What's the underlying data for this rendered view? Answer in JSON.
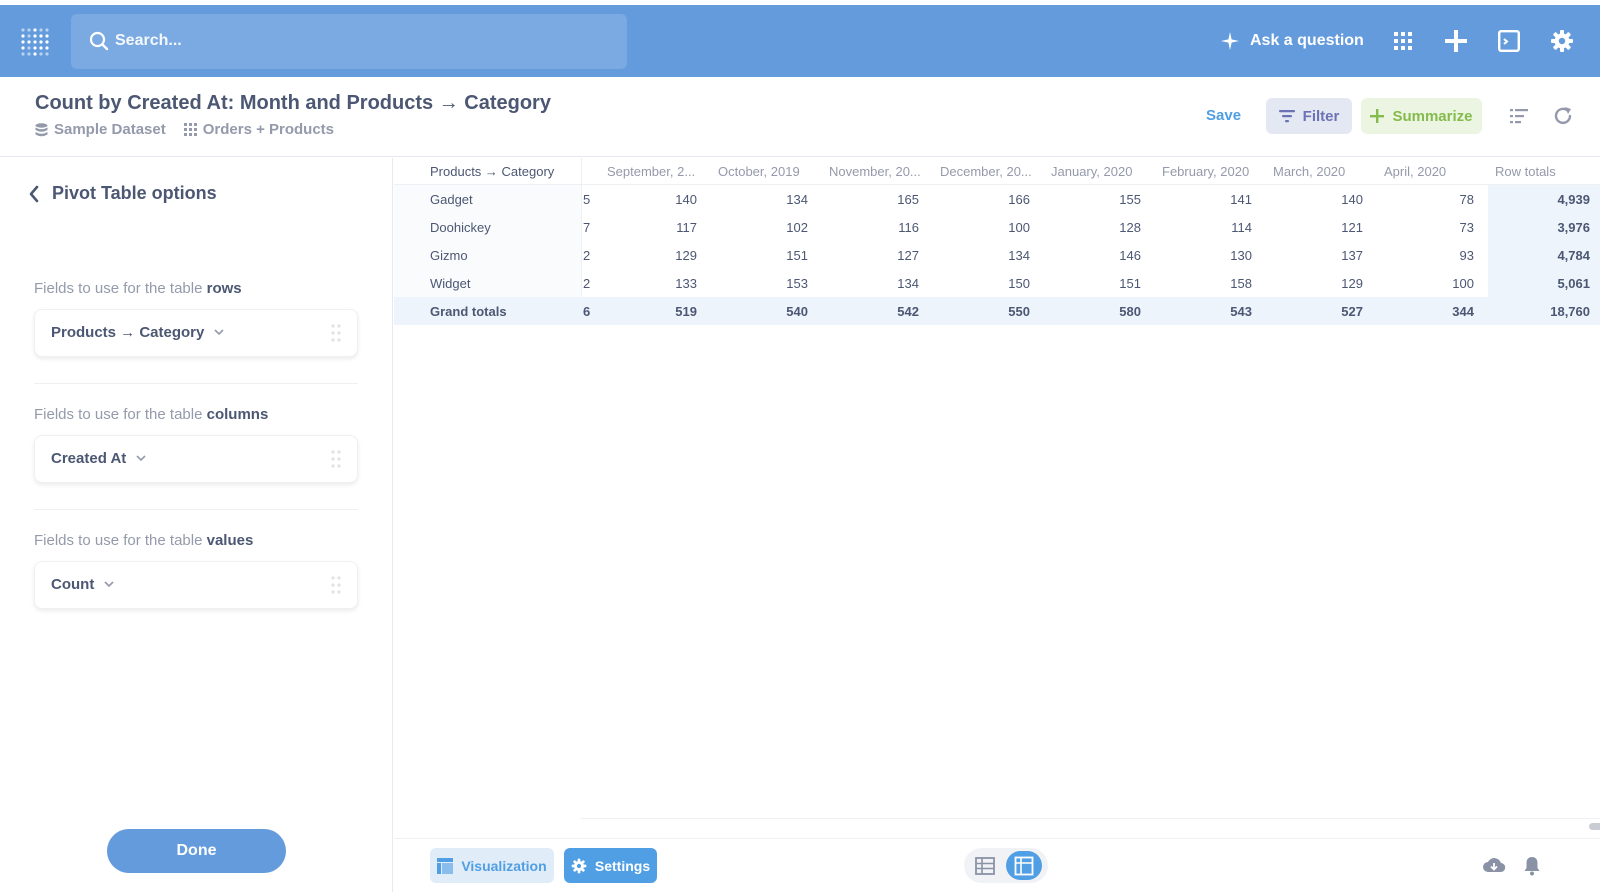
{
  "nav": {
    "search_placeholder": "Search...",
    "ask_label": "Ask a question"
  },
  "header": {
    "title": "Count by Created At: Month and Products → Category",
    "breadcrumbs": [
      "Sample Dataset",
      "Orders + Products"
    ],
    "save_label": "Save",
    "filter_label": "Filter",
    "summarize_label": "Summarize"
  },
  "sidebar": {
    "title": "Pivot Table options",
    "sections": [
      {
        "prefix": "Fields to use for the table ",
        "emphasis": "rows",
        "field": "Products → Category"
      },
      {
        "prefix": "Fields to use for the table ",
        "emphasis": "columns",
        "field": "Created At"
      },
      {
        "prefix": "Fields to use for the table ",
        "emphasis": "values",
        "field": "Count"
      }
    ],
    "done_label": "Done"
  },
  "table": {
    "row_header_title": "Products → Category",
    "columns": [
      "September, 2...",
      "October, 2019",
      "November, 20...",
      "December, 20...",
      "January, 2020",
      "February, 2020",
      "March, 2020",
      "April, 2020",
      "Row totals"
    ],
    "rows": [
      {
        "label": "Gadget",
        "partial": "5",
        "values": [
          "140",
          "134",
          "165",
          "166",
          "155",
          "141",
          "140",
          "78"
        ],
        "total": "4,939"
      },
      {
        "label": "Doohickey",
        "partial": "7",
        "values": [
          "117",
          "102",
          "116",
          "100",
          "128",
          "114",
          "121",
          "73"
        ],
        "total": "3,976"
      },
      {
        "label": "Gizmo",
        "partial": "2",
        "values": [
          "129",
          "151",
          "127",
          "134",
          "146",
          "130",
          "137",
          "93"
        ],
        "total": "4,784"
      },
      {
        "label": "Widget",
        "partial": "2",
        "values": [
          "133",
          "153",
          "134",
          "150",
          "151",
          "158",
          "129",
          "100"
        ],
        "total": "5,061"
      }
    ],
    "grand": {
      "label": "Grand totals",
      "partial": "6",
      "values": [
        "519",
        "540",
        "542",
        "550",
        "580",
        "543",
        "527",
        "344"
      ],
      "total": "18,760"
    }
  },
  "footer": {
    "visualization_label": "Visualization",
    "settings_label": "Settings"
  },
  "colors": {
    "brand": "#509ee3",
    "nav_bg": "#639bdc",
    "summarize": "#84bb4c",
    "filter": "#6c73b5"
  }
}
